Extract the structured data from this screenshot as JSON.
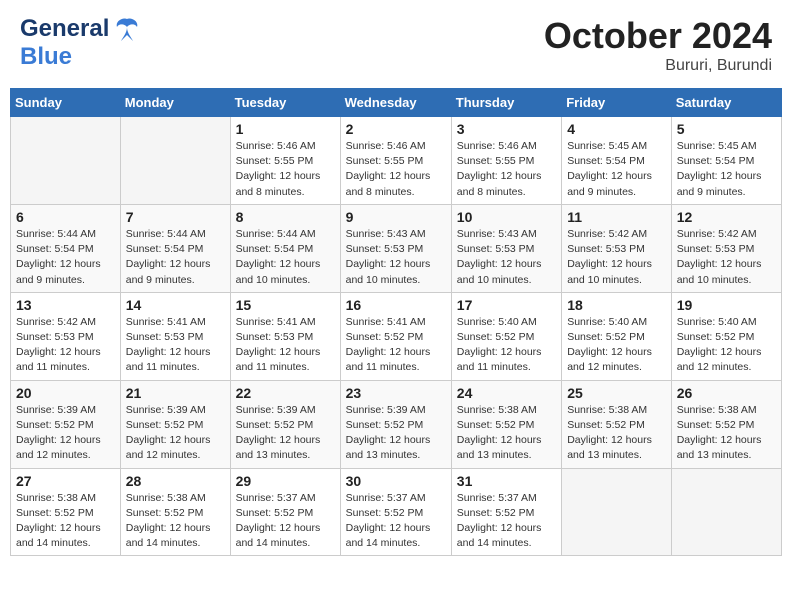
{
  "header": {
    "logo_general": "General",
    "logo_blue": "Blue",
    "month_year": "October 2024",
    "location": "Bururi, Burundi"
  },
  "weekdays": [
    "Sunday",
    "Monday",
    "Tuesday",
    "Wednesday",
    "Thursday",
    "Friday",
    "Saturday"
  ],
  "weeks": [
    [
      {
        "day": "",
        "empty": true
      },
      {
        "day": "",
        "empty": true
      },
      {
        "day": "1",
        "sunrise": "5:46 AM",
        "sunset": "5:55 PM",
        "daylight": "12 hours and 8 minutes."
      },
      {
        "day": "2",
        "sunrise": "5:46 AM",
        "sunset": "5:55 PM",
        "daylight": "12 hours and 8 minutes."
      },
      {
        "day": "3",
        "sunrise": "5:46 AM",
        "sunset": "5:55 PM",
        "daylight": "12 hours and 8 minutes."
      },
      {
        "day": "4",
        "sunrise": "5:45 AM",
        "sunset": "5:54 PM",
        "daylight": "12 hours and 9 minutes."
      },
      {
        "day": "5",
        "sunrise": "5:45 AM",
        "sunset": "5:54 PM",
        "daylight": "12 hours and 9 minutes."
      }
    ],
    [
      {
        "day": "6",
        "sunrise": "5:44 AM",
        "sunset": "5:54 PM",
        "daylight": "12 hours and 9 minutes."
      },
      {
        "day": "7",
        "sunrise": "5:44 AM",
        "sunset": "5:54 PM",
        "daylight": "12 hours and 9 minutes."
      },
      {
        "day": "8",
        "sunrise": "5:44 AM",
        "sunset": "5:54 PM",
        "daylight": "12 hours and 10 minutes."
      },
      {
        "day": "9",
        "sunrise": "5:43 AM",
        "sunset": "5:53 PM",
        "daylight": "12 hours and 10 minutes."
      },
      {
        "day": "10",
        "sunrise": "5:43 AM",
        "sunset": "5:53 PM",
        "daylight": "12 hours and 10 minutes."
      },
      {
        "day": "11",
        "sunrise": "5:42 AM",
        "sunset": "5:53 PM",
        "daylight": "12 hours and 10 minutes."
      },
      {
        "day": "12",
        "sunrise": "5:42 AM",
        "sunset": "5:53 PM",
        "daylight": "12 hours and 10 minutes."
      }
    ],
    [
      {
        "day": "13",
        "sunrise": "5:42 AM",
        "sunset": "5:53 PM",
        "daylight": "12 hours and 11 minutes."
      },
      {
        "day": "14",
        "sunrise": "5:41 AM",
        "sunset": "5:53 PM",
        "daylight": "12 hours and 11 minutes."
      },
      {
        "day": "15",
        "sunrise": "5:41 AM",
        "sunset": "5:53 PM",
        "daylight": "12 hours and 11 minutes."
      },
      {
        "day": "16",
        "sunrise": "5:41 AM",
        "sunset": "5:52 PM",
        "daylight": "12 hours and 11 minutes."
      },
      {
        "day": "17",
        "sunrise": "5:40 AM",
        "sunset": "5:52 PM",
        "daylight": "12 hours and 11 minutes."
      },
      {
        "day": "18",
        "sunrise": "5:40 AM",
        "sunset": "5:52 PM",
        "daylight": "12 hours and 12 minutes."
      },
      {
        "day": "19",
        "sunrise": "5:40 AM",
        "sunset": "5:52 PM",
        "daylight": "12 hours and 12 minutes."
      }
    ],
    [
      {
        "day": "20",
        "sunrise": "5:39 AM",
        "sunset": "5:52 PM",
        "daylight": "12 hours and 12 minutes."
      },
      {
        "day": "21",
        "sunrise": "5:39 AM",
        "sunset": "5:52 PM",
        "daylight": "12 hours and 12 minutes."
      },
      {
        "day": "22",
        "sunrise": "5:39 AM",
        "sunset": "5:52 PM",
        "daylight": "12 hours and 13 minutes."
      },
      {
        "day": "23",
        "sunrise": "5:39 AM",
        "sunset": "5:52 PM",
        "daylight": "12 hours and 13 minutes."
      },
      {
        "day": "24",
        "sunrise": "5:38 AM",
        "sunset": "5:52 PM",
        "daylight": "12 hours and 13 minutes."
      },
      {
        "day": "25",
        "sunrise": "5:38 AM",
        "sunset": "5:52 PM",
        "daylight": "12 hours and 13 minutes."
      },
      {
        "day": "26",
        "sunrise": "5:38 AM",
        "sunset": "5:52 PM",
        "daylight": "12 hours and 13 minutes."
      }
    ],
    [
      {
        "day": "27",
        "sunrise": "5:38 AM",
        "sunset": "5:52 PM",
        "daylight": "12 hours and 14 minutes."
      },
      {
        "day": "28",
        "sunrise": "5:38 AM",
        "sunset": "5:52 PM",
        "daylight": "12 hours and 14 minutes."
      },
      {
        "day": "29",
        "sunrise": "5:37 AM",
        "sunset": "5:52 PM",
        "daylight": "12 hours and 14 minutes."
      },
      {
        "day": "30",
        "sunrise": "5:37 AM",
        "sunset": "5:52 PM",
        "daylight": "12 hours and 14 minutes."
      },
      {
        "day": "31",
        "sunrise": "5:37 AM",
        "sunset": "5:52 PM",
        "daylight": "12 hours and 14 minutes."
      },
      {
        "day": "",
        "empty": true
      },
      {
        "day": "",
        "empty": true
      }
    ]
  ],
  "labels": {
    "sunrise": "Sunrise:",
    "sunset": "Sunset:",
    "daylight": "Daylight:"
  }
}
